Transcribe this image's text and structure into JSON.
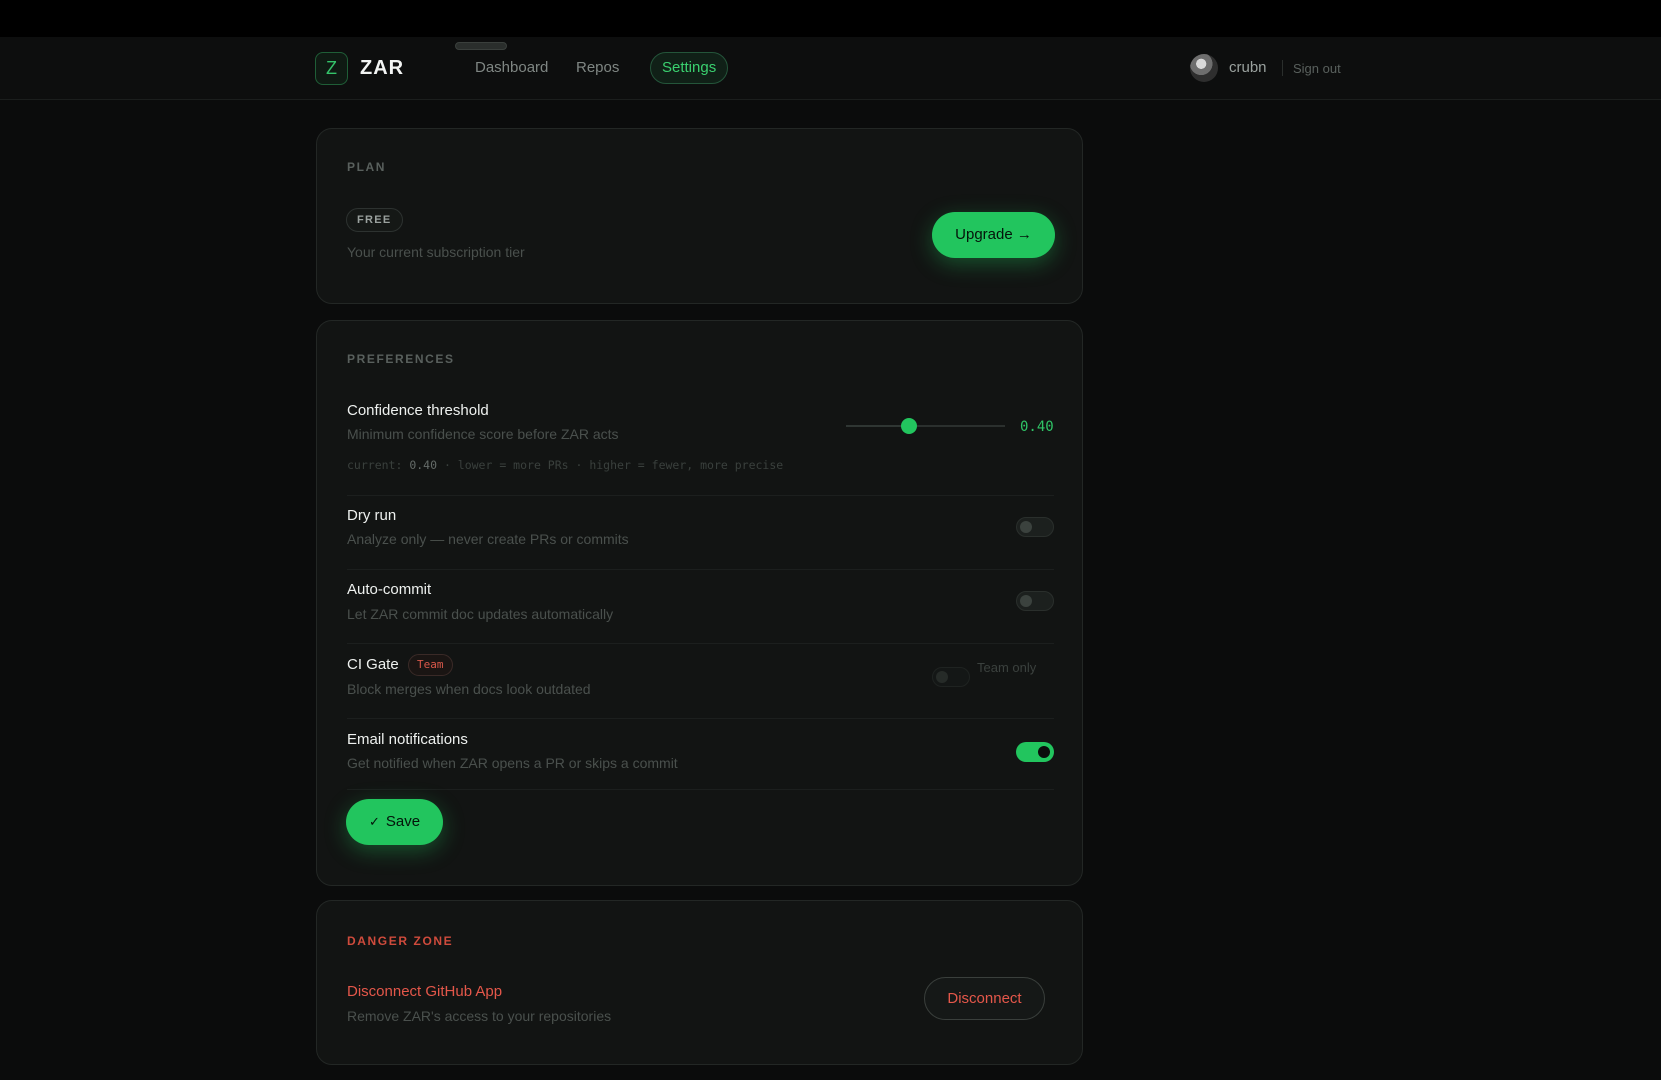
{
  "header": {
    "logo_letter": "Z",
    "brand": "ZAR",
    "nav": [
      {
        "label": "Dashboard"
      },
      {
        "label": "Repos"
      },
      {
        "label": "Settings",
        "active": true
      }
    ],
    "username": "crubn",
    "signout_label": "Sign out"
  },
  "plan": {
    "section_title": "PLAN",
    "badge": "FREE",
    "description": "Your current subscription tier",
    "upgrade_label": "Upgrade →"
  },
  "preferences": {
    "section_title": "PREFERENCES",
    "confidence": {
      "label": "Confidence threshold",
      "description": "Minimum confidence score before ZAR acts",
      "value_display": "0.40",
      "value": 0.4,
      "hint_prefix": "current: ",
      "hint_value": "0.40",
      "hint_suffix": " · lower = more PRs · higher = fewer, more precise"
    },
    "dry_run": {
      "label": "Dry run",
      "description": "Analyze only — never create PRs or commits",
      "enabled": false
    },
    "auto_commit": {
      "label": "Auto-commit",
      "description": "Let ZAR commit doc updates automatically",
      "enabled": false
    },
    "ci_gate": {
      "label": "CI Gate",
      "badge": "Team",
      "description": "Block merges when docs look outdated",
      "enabled": false,
      "note": "Team only"
    },
    "email_notifications": {
      "label": "Email notifications",
      "description": "Get notified when ZAR opens a PR or skips a commit",
      "enabled": true
    },
    "save_label": "Save"
  },
  "danger": {
    "section_title": "DANGER ZONE",
    "label": "Disconnect GitHub App",
    "description": "Remove ZAR's access to your repositories",
    "button_label": "Disconnect"
  },
  "colors": {
    "accent": "#22c55e",
    "danger": "#e4574a",
    "background": "#0b0c0c"
  }
}
